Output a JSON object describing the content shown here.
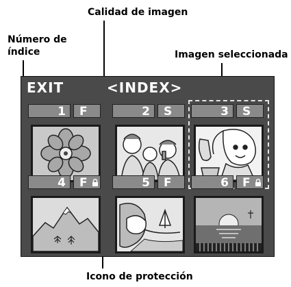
{
  "callouts": {
    "calidad": "Calidad de imagen",
    "numero_line1": "Número de",
    "numero_line2": "índice",
    "seleccionada": "Imagen seleccionada",
    "proteccion": "Icono de protección"
  },
  "screen": {
    "exit": "EXIT",
    "title": "<INDEX>",
    "items": [
      {
        "index": "1",
        "quality": "F",
        "protected": false,
        "image": "flower-icon"
      },
      {
        "index": "2",
        "quality": "S",
        "protected": false,
        "image": "family-icon"
      },
      {
        "index": "3",
        "quality": "S",
        "protected": false,
        "selected": true,
        "image": "woman-phone-icon"
      },
      {
        "index": "4",
        "quality": "F",
        "protected": true,
        "image": "mountain-icon"
      },
      {
        "index": "5",
        "quality": "F",
        "protected": false,
        "image": "beach-icon"
      },
      {
        "index": "6",
        "quality": "F",
        "protected": true,
        "image": "sunset-icon"
      }
    ]
  },
  "colors": {
    "screen_bg": "#4a4a4a",
    "label_box": "#8a8a8a",
    "text": "#ffffff"
  }
}
